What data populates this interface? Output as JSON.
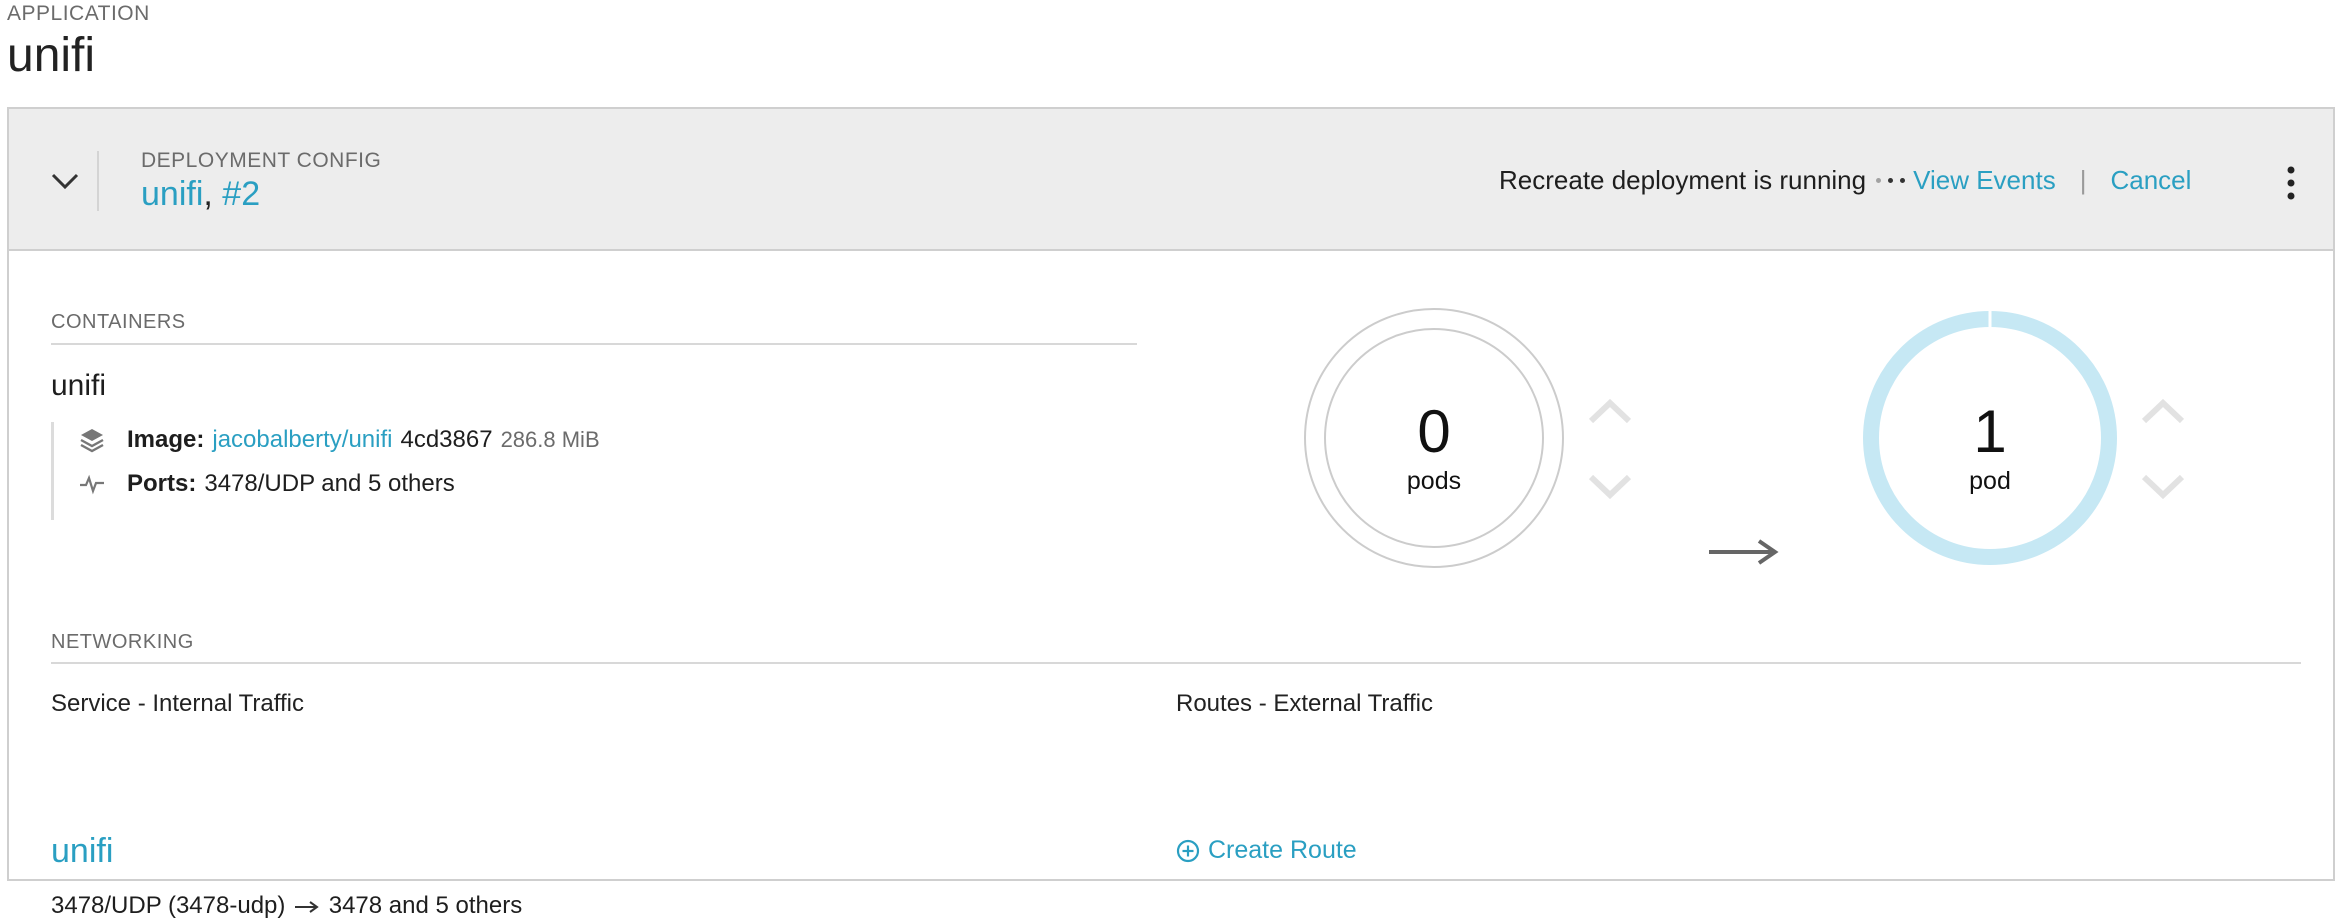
{
  "application": {
    "label": "APPLICATION",
    "name": "unifi"
  },
  "deployment": {
    "label": "DEPLOYMENT CONFIG",
    "name": "unifi",
    "separator": ",",
    "revision": "#2",
    "status": "Recreate deployment is running",
    "view_events": "View Events",
    "pipe": "|",
    "cancel": "Cancel"
  },
  "containers": {
    "label": "CONTAINERS",
    "name": "unifi",
    "image_label": "Image:",
    "image_link": "jacobalberty/unifi",
    "image_hash": "4cd3867",
    "image_size": "286.8 MiB",
    "ports_label": "Ports:",
    "ports_value": "3478/UDP and 5 others"
  },
  "pods": {
    "old": {
      "count": "0",
      "unit": "pods"
    },
    "new": {
      "count": "1",
      "unit": "pod"
    }
  },
  "networking": {
    "label": "NETWORKING",
    "service_title": "Service - Internal Traffic",
    "service_name": "unifi",
    "service_port_left": "3478/UDP (3478-udp)",
    "service_port_right": "3478 and 5 others",
    "routes_title": "Routes - External Traffic",
    "create_route": "Create Route"
  },
  "colors": {
    "link": "#2a9fc2",
    "header_bg": "#ededed",
    "donut_new": "#c6e8f4",
    "donut_old": "#cccccc"
  },
  "icons": [
    "chevron-down-icon",
    "kebab-icon",
    "layers-icon",
    "pulse-icon",
    "chevron-up-icon",
    "arrow-right-icon",
    "plus-circle-icon"
  ]
}
